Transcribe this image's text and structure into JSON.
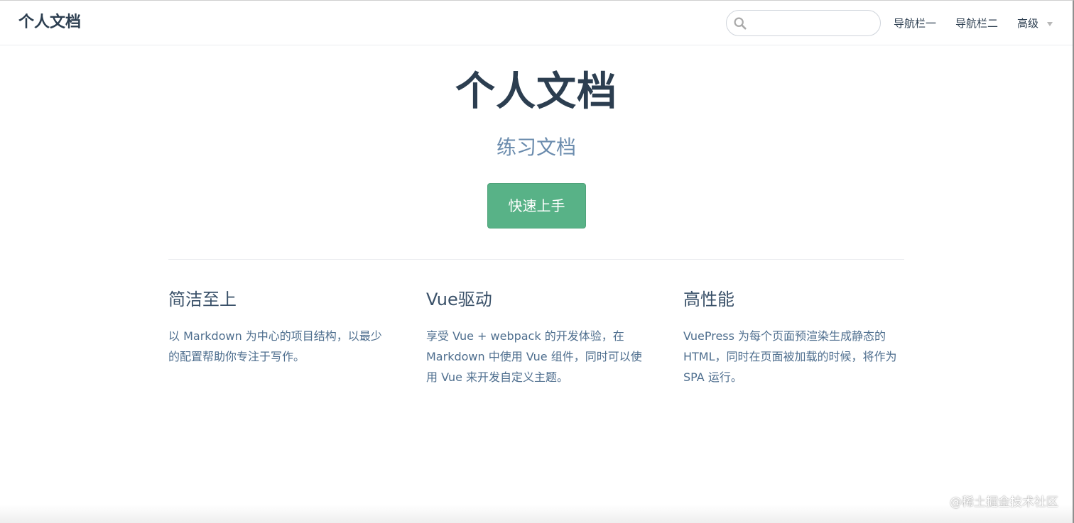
{
  "navbar": {
    "site_name": "个人文档",
    "search": {
      "value": "",
      "placeholder": ""
    },
    "links": [
      {
        "label": "导航栏一"
      },
      {
        "label": "导航栏二"
      }
    ],
    "dropdown": {
      "label": "高级"
    }
  },
  "hero": {
    "title": "个人文档",
    "description": "练习文档",
    "action_label": "快速上手"
  },
  "features": [
    {
      "title": "简洁至上",
      "details": "以 Markdown 为中心的项目结构，以最少的配置帮助你专注于写作。"
    },
    {
      "title": "Vue驱动",
      "details": "享受 Vue + webpack 的开发体验，在 Markdown 中使用 Vue 组件，同时可以使用 Vue 来开发自定义主题。"
    },
    {
      "title": "高性能",
      "details": "VuePress 为每个页面预渲染生成静态的 HTML，同时在页面被加载的时候，将作为 SPA 运行。"
    }
  ],
  "watermark": "@稀土掘金技术社区",
  "colors": {
    "accent": "#58b287",
    "text": "#2c3e50",
    "muted": "#6a8bad"
  },
  "icons": {
    "search": "search-icon",
    "dropdown": "chevron-down-icon"
  }
}
